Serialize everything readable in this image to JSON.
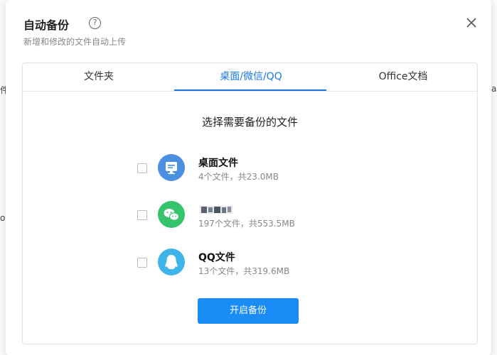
{
  "dialog": {
    "title": "自动备份",
    "help_icon": "help-circle-icon",
    "subtitle": "新增和修改的文件自动上传",
    "close_icon": "close-icon"
  },
  "tabs": [
    {
      "label": "文件夹",
      "active": false
    },
    {
      "label": "桌面/微信/QQ",
      "active": true
    },
    {
      "label": "Office文档",
      "active": false
    }
  ],
  "panel": {
    "heading": "选择需要备份的文件",
    "items": [
      {
        "icon": "desktop-icon",
        "name": "桌面文件",
        "meta": "4个文件，共23.0MB",
        "checked": false,
        "color": "#4a8fe0"
      },
      {
        "icon": "wechat-icon",
        "name": "",
        "meta": "197个文件，共553.5MB",
        "checked": false,
        "color": "#35c46b"
      },
      {
        "icon": "qq-icon",
        "name": "QQ文件",
        "meta": "13个文件，共319.6MB",
        "checked": false,
        "color": "#3fb4e8"
      }
    ],
    "start_button": "开启备份"
  },
  "colors": {
    "accent": "#1a78e6",
    "button": "#1a8cf5"
  }
}
